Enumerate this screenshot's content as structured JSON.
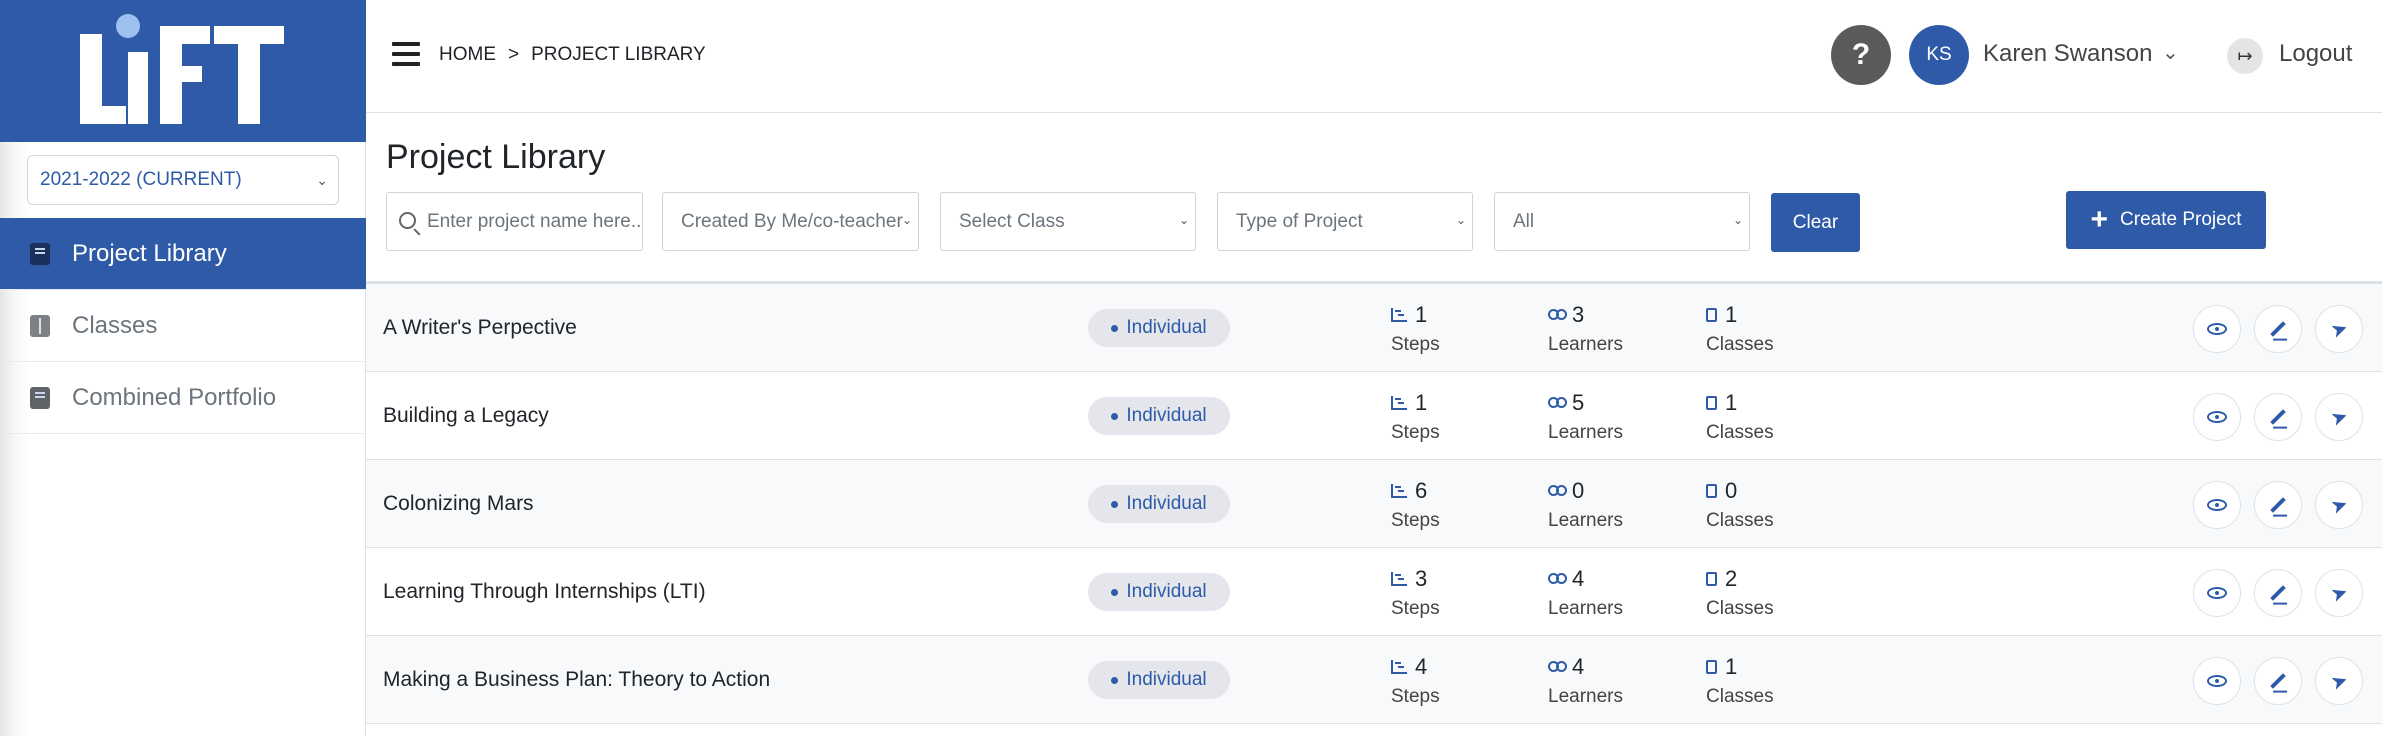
{
  "sidebar": {
    "logo_text": "LiFT",
    "year_select": "2021-2022 (CURRENT)",
    "items": [
      {
        "label": "Project Library",
        "active": true
      },
      {
        "label": "Classes",
        "active": false
      },
      {
        "label": "Combined Portfolio",
        "active": false
      }
    ]
  },
  "header": {
    "breadcrumb": {
      "home": "HOME",
      "separator": ">",
      "current": "PROJECT LIBRARY"
    },
    "help_label": "?",
    "avatar_initials": "KS",
    "user_name": "Karen Swanson",
    "logout_label": "Logout"
  },
  "main": {
    "title": "Project Library",
    "filters": {
      "search_placeholder": "Enter project name here...",
      "created_by": "Created By Me/co-teacher",
      "class": "Select Class",
      "type": "Type of Project",
      "status": "All"
    },
    "clear_label": "Clear",
    "create_label": "Create Project",
    "stat_labels": {
      "steps": "Steps",
      "learners": "Learners",
      "classes": "Classes"
    },
    "projects": [
      {
        "name": "A Writer's Perpective",
        "type": "Individual",
        "steps": "1",
        "learners": "3",
        "classes": "1"
      },
      {
        "name": "Building a Legacy",
        "type": "Individual",
        "steps": "1",
        "learners": "5",
        "classes": "1"
      },
      {
        "name": "Colonizing Mars",
        "type": "Individual",
        "steps": "6",
        "learners": "0",
        "classes": "0"
      },
      {
        "name": "Learning Through Internships (LTI)",
        "type": "Individual",
        "steps": "3",
        "learners": "4",
        "classes": "2"
      },
      {
        "name": "Making a Business Plan: Theory to Action",
        "type": "Individual",
        "steps": "4",
        "learners": "4",
        "classes": "1"
      }
    ]
  },
  "colors": {
    "brand": "#2e5aa7",
    "badge_bg": "#e4e6eb"
  }
}
